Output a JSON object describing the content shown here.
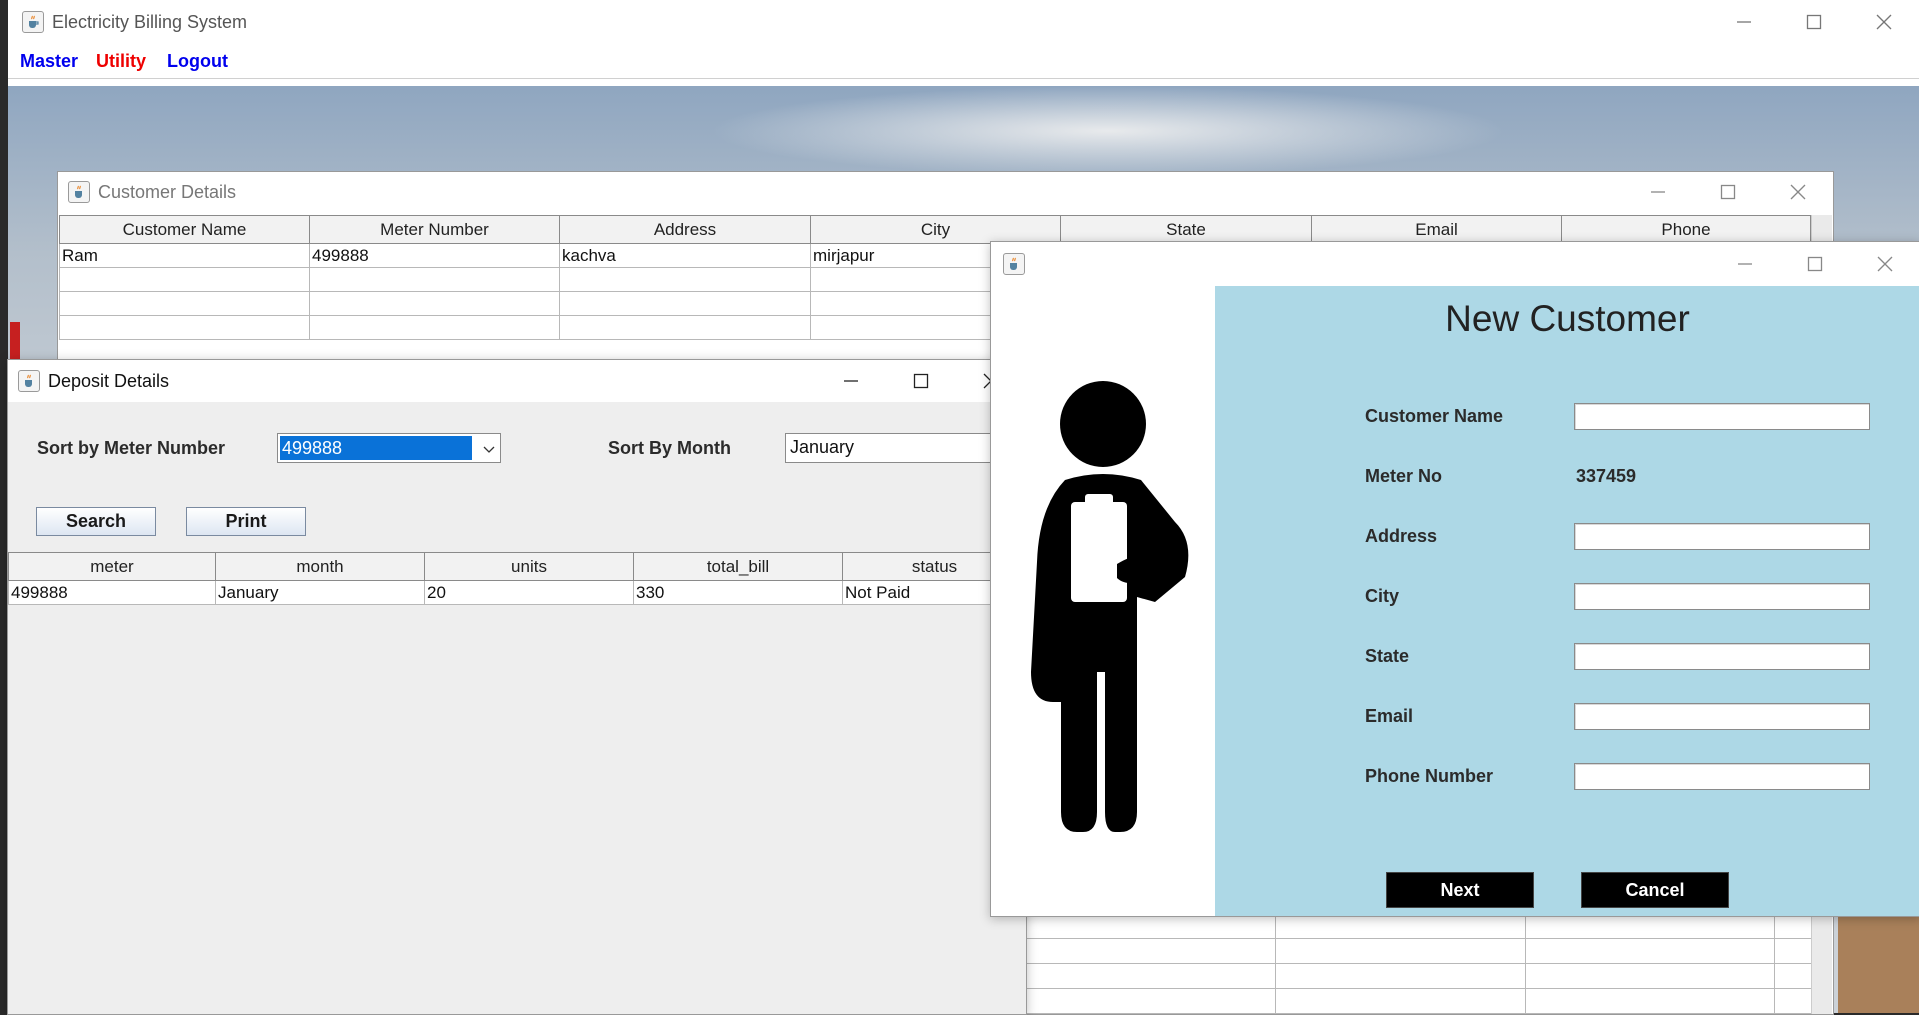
{
  "main_window": {
    "title": "Electricity Billing System",
    "menu": [
      {
        "label": "Master",
        "color": "#0000ee"
      },
      {
        "label": "Utility",
        "color": "#ee0000"
      },
      {
        "label": "Logout",
        "color": "#0000ee"
      }
    ]
  },
  "customer_details": {
    "title": "Customer Details",
    "columns": [
      "Customer Name",
      "Meter Number",
      "Address",
      "City",
      "State",
      "Email",
      "Phone"
    ],
    "rows": [
      [
        "Ram",
        "499888",
        "kachva",
        "mirjapur",
        "",
        "",
        ""
      ]
    ]
  },
  "deposit_details": {
    "title": "Deposit Details",
    "sort_meter_label": "Sort by Meter Number",
    "sort_meter_value": "499888",
    "sort_month_label": "Sort By Month",
    "sort_month_value": "January",
    "search_label": "Search",
    "print_label": "Print",
    "columns": [
      "meter",
      "month",
      "units",
      "total_bill",
      "status"
    ],
    "rows": [
      [
        "499888",
        "January",
        "20",
        "330",
        "Not Paid"
      ]
    ]
  },
  "new_customer": {
    "heading": "New Customer",
    "customer_name_label": "Customer Name",
    "meter_no_label": "Meter No",
    "meter_no_value": "337459",
    "address_label": "Address",
    "city_label": "City",
    "state_label": "State",
    "email_label": "Email",
    "phone_label": "Phone Number",
    "next_label": "Next",
    "cancel_label": "Cancel",
    "panel_color": "#add8e6"
  },
  "icons": {
    "app_icon": "java-cup-icon",
    "minimize": "minimize-icon",
    "maximize": "maximize-icon",
    "close": "close-icon",
    "dropdown": "chevron-down-icon",
    "customer_figure": "person-with-clipboard-icon"
  }
}
